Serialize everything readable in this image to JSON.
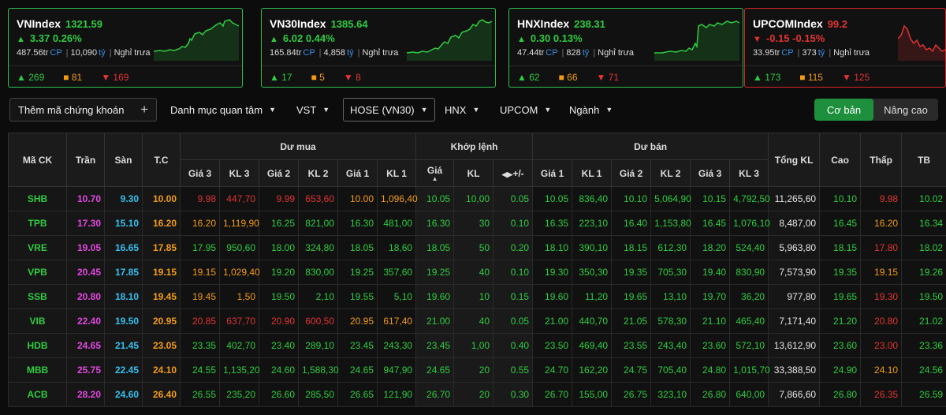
{
  "indices": [
    {
      "name": "VNIndex",
      "value": "1321.59",
      "change": "3.37",
      "pct": "0.26%",
      "dir": "up",
      "vol": "487.56tr",
      "vol_unit": "CP",
      "val": "10,090",
      "val_unit": "tỷ",
      "status": "Nghỉ trưa",
      "up": "269",
      "ref": "81",
      "down": "169"
    },
    {
      "name": "VN30Index",
      "value": "1385.64",
      "change": "6.02",
      "pct": "0.44%",
      "dir": "up",
      "vol": "165.84tr",
      "vol_unit": "CP",
      "val": "4,858",
      "val_unit": "tỷ",
      "status": "Nghỉ trưa",
      "up": "17",
      "ref": "5",
      "down": "8"
    },
    {
      "name": "HNXIndex",
      "value": "238.31",
      "change": "0.30",
      "pct": "0.13%",
      "dir": "up",
      "vol": "47.44tr",
      "vol_unit": "CP",
      "val": "828",
      "val_unit": "tỷ",
      "status": "Nghỉ trưa",
      "up": "62",
      "ref": "66",
      "down": "71"
    },
    {
      "name": "UPCOMIndex",
      "value": "99.2",
      "change": "-0.15",
      "pct": "-0.15%",
      "dir": "down",
      "vol": "33.95tr",
      "vol_unit": "CP",
      "val": "373",
      "val_unit": "tỷ",
      "status": "Nghỉ trưa",
      "up": "173",
      "ref": "115",
      "down": "125"
    }
  ],
  "toolbar": {
    "add_label": "Thêm mã chứng khoán",
    "watchlist": "Danh mục quan tâm",
    "vst": "VST",
    "hose": "HOSE (VN30)",
    "hnx": "HNX",
    "upcom": "UPCOM",
    "sector": "Ngành",
    "basic": "Cơ bản",
    "advanced": "Nâng cao"
  },
  "headers": {
    "symbol": "Mã CK",
    "ceil": "Trần",
    "floor": "Sàn",
    "ref": "T.C",
    "bid": "Dư mua",
    "match": "Khớp lệnh",
    "ask": "Dư bán",
    "total": "Tổng KL",
    "high": "Cao",
    "low": "Thấp",
    "avg": "TB",
    "p3": "Giá 3",
    "v3": "KL 3",
    "p2": "Giá 2",
    "v2": "KL 2",
    "p1": "Giá 1",
    "v1": "KL 1",
    "mprice": "Giá",
    "mvol": "KL",
    "mchg": "+/-"
  },
  "colors": {
    "up": "#2ecc40",
    "down": "#e23434",
    "ref": "#f39c12",
    "ceil": "#e347e3",
    "floor": "#36c0ef"
  },
  "rows": [
    {
      "sym": "SHB",
      "ceil": "10.70",
      "floor": "9.30",
      "ref": "10.00",
      "b3p": "9.98",
      "b3v": "447,70",
      "b2p": "9.99",
      "b2v": "653,60",
      "b1p": "10.00",
      "b1v": "1,096,40",
      "mp": "10.05",
      "mv": "10,00",
      "mc": "0.05",
      "a1p": "10.05",
      "a1v": "836,40",
      "a2p": "10.10",
      "a2v": "5,064,90",
      "a3p": "10.15",
      "a3v": "4,792,50",
      "tot": "11,265,60",
      "hi": "10.10",
      "lo": "9.98",
      "avg": "10.02",
      "cl": {
        "sym": "g",
        "b3": "r",
        "b2": "r",
        "b1": "o",
        "m": "g",
        "a1": "g",
        "a2": "g",
        "a3": "g",
        "hi": "g",
        "lo": "r",
        "avg": "g"
      }
    },
    {
      "sym": "TPB",
      "ceil": "17.30",
      "floor": "15.10",
      "ref": "16.20",
      "b3p": "16.20",
      "b3v": "1,119,90",
      "b2p": "16.25",
      "b2v": "821,00",
      "b1p": "16.30",
      "b1v": "481,00",
      "mp": "16.30",
      "mv": "30",
      "mc": "0.10",
      "a1p": "16.35",
      "a1v": "223,10",
      "a2p": "16.40",
      "a2v": "1,153,80",
      "a3p": "16.45",
      "a3v": "1,076,10",
      "tot": "8,487,00",
      "hi": "16.45",
      "lo": "16.20",
      "avg": "16.34",
      "cl": {
        "sym": "g",
        "b3": "o",
        "b2": "g",
        "b1": "g",
        "m": "g",
        "a1": "g",
        "a2": "g",
        "a3": "g",
        "hi": "g",
        "lo": "o",
        "avg": "g"
      }
    },
    {
      "sym": "VRE",
      "ceil": "19.05",
      "floor": "16.65",
      "ref": "17.85",
      "b3p": "17.95",
      "b3v": "950,60",
      "b2p": "18.00",
      "b2v": "324,80",
      "b1p": "18.05",
      "b1v": "18,60",
      "mp": "18.05",
      "mv": "50",
      "mc": "0.20",
      "a1p": "18.10",
      "a1v": "390,10",
      "a2p": "18.15",
      "a2v": "612,30",
      "a3p": "18.20",
      "a3v": "524,40",
      "tot": "5,963,80",
      "hi": "18.15",
      "lo": "17.80",
      "avg": "18.02",
      "cl": {
        "sym": "g",
        "b3": "g",
        "b2": "g",
        "b1": "g",
        "m": "g",
        "a1": "g",
        "a2": "g",
        "a3": "g",
        "hi": "g",
        "lo": "r",
        "avg": "g"
      }
    },
    {
      "sym": "VPB",
      "ceil": "20.45",
      "floor": "17.85",
      "ref": "19.15",
      "b3p": "19.15",
      "b3v": "1,029,40",
      "b2p": "19.20",
      "b2v": "830,00",
      "b1p": "19.25",
      "b1v": "357,60",
      "mp": "19.25",
      "mv": "40",
      "mc": "0.10",
      "a1p": "19.30",
      "a1v": "350,30",
      "a2p": "19.35",
      "a2v": "705,30",
      "a3p": "19.40",
      "a3v": "830,90",
      "tot": "7,573,90",
      "hi": "19.35",
      "lo": "19.15",
      "avg": "19.26",
      "cl": {
        "sym": "g",
        "b3": "o",
        "b2": "g",
        "b1": "g",
        "m": "g",
        "a1": "g",
        "a2": "g",
        "a3": "g",
        "hi": "g",
        "lo": "o",
        "avg": "g"
      }
    },
    {
      "sym": "SSB",
      "ceil": "20.80",
      "floor": "18.10",
      "ref": "19.45",
      "b3p": "19.45",
      "b3v": "1,50",
      "b2p": "19.50",
      "b2v": "2,10",
      "b1p": "19.55",
      "b1v": "5,10",
      "mp": "19.60",
      "mv": "10",
      "mc": "0.15",
      "a1p": "19.60",
      "a1v": "11,20",
      "a2p": "19.65",
      "a2v": "13,10",
      "a3p": "19.70",
      "a3v": "36,20",
      "tot": "977,80",
      "hi": "19.65",
      "lo": "19.30",
      "avg": "19.50",
      "cl": {
        "sym": "g",
        "b3": "o",
        "b2": "g",
        "b1": "g",
        "m": "g",
        "a1": "g",
        "a2": "g",
        "a3": "g",
        "hi": "g",
        "lo": "r",
        "avg": "g"
      }
    },
    {
      "sym": "VIB",
      "ceil": "22.40",
      "floor": "19.50",
      "ref": "20.95",
      "b3p": "20.85",
      "b3v": "637,70",
      "b2p": "20.90",
      "b2v": "600,50",
      "b1p": "20.95",
      "b1v": "617,40",
      "mp": "21.00",
      "mv": "40",
      "mc": "0.05",
      "a1p": "21.00",
      "a1v": "440,70",
      "a2p": "21.05",
      "a2v": "578,30",
      "a3p": "21.10",
      "a3v": "465,40",
      "tot": "7,171,40",
      "hi": "21.20",
      "lo": "20.80",
      "avg": "21.02",
      "cl": {
        "sym": "g",
        "b3": "r",
        "b2": "r",
        "b1": "o",
        "m": "g",
        "a1": "g",
        "a2": "g",
        "a3": "g",
        "hi": "g",
        "lo": "r",
        "avg": "g"
      }
    },
    {
      "sym": "HDB",
      "ceil": "24.65",
      "floor": "21.45",
      "ref": "23.05",
      "b3p": "23.35",
      "b3v": "402,70",
      "b2p": "23.40",
      "b2v": "289,10",
      "b1p": "23.45",
      "b1v": "243,30",
      "mp": "23.45",
      "mv": "1,00",
      "mc": "0.40",
      "a1p": "23.50",
      "a1v": "469,40",
      "a2p": "23.55",
      "a2v": "243,40",
      "a3p": "23.60",
      "a3v": "572,10",
      "tot": "13,612,90",
      "hi": "23.60",
      "lo": "23.00",
      "avg": "23.36",
      "cl": {
        "sym": "g",
        "b3": "g",
        "b2": "g",
        "b1": "g",
        "m": "g",
        "a1": "g",
        "a2": "g",
        "a3": "g",
        "hi": "g",
        "lo": "r",
        "avg": "g"
      }
    },
    {
      "sym": "MBB",
      "ceil": "25.75",
      "floor": "22.45",
      "ref": "24.10",
      "b3p": "24.55",
      "b3v": "1,135,20",
      "b2p": "24.60",
      "b2v": "1,588,30",
      "b1p": "24.65",
      "b1v": "947,90",
      "mp": "24.65",
      "mv": "20",
      "mc": "0.55",
      "a1p": "24.70",
      "a1v": "162,20",
      "a2p": "24.75",
      "a2v": "705,40",
      "a3p": "24.80",
      "a3v": "1,015,70",
      "tot": "33,388,50",
      "hi": "24.90",
      "lo": "24.10",
      "avg": "24.56",
      "cl": {
        "sym": "g",
        "b3": "g",
        "b2": "g",
        "b1": "g",
        "m": "g",
        "a1": "g",
        "a2": "g",
        "a3": "g",
        "hi": "g",
        "lo": "o",
        "avg": "g"
      }
    },
    {
      "sym": "ACB",
      "ceil": "28.20",
      "floor": "24.60",
      "ref": "26.40",
      "b3p": "26.55",
      "b3v": "235,20",
      "b2p": "26.60",
      "b2v": "285,50",
      "b1p": "26.65",
      "b1v": "121,90",
      "mp": "26.70",
      "mv": "20",
      "mc": "0.30",
      "a1p": "26.70",
      "a1v": "155,00",
      "a2p": "26.75",
      "a2v": "323,10",
      "a3p": "26.80",
      "a3v": "640,00",
      "tot": "7,866,60",
      "hi": "26.80",
      "lo": "26.35",
      "avg": "26.59",
      "cl": {
        "sym": "g",
        "b3": "g",
        "b2": "g",
        "b1": "g",
        "m": "g",
        "a1": "g",
        "a2": "g",
        "a3": "g",
        "hi": "g",
        "lo": "r",
        "avg": "g"
      }
    }
  ]
}
